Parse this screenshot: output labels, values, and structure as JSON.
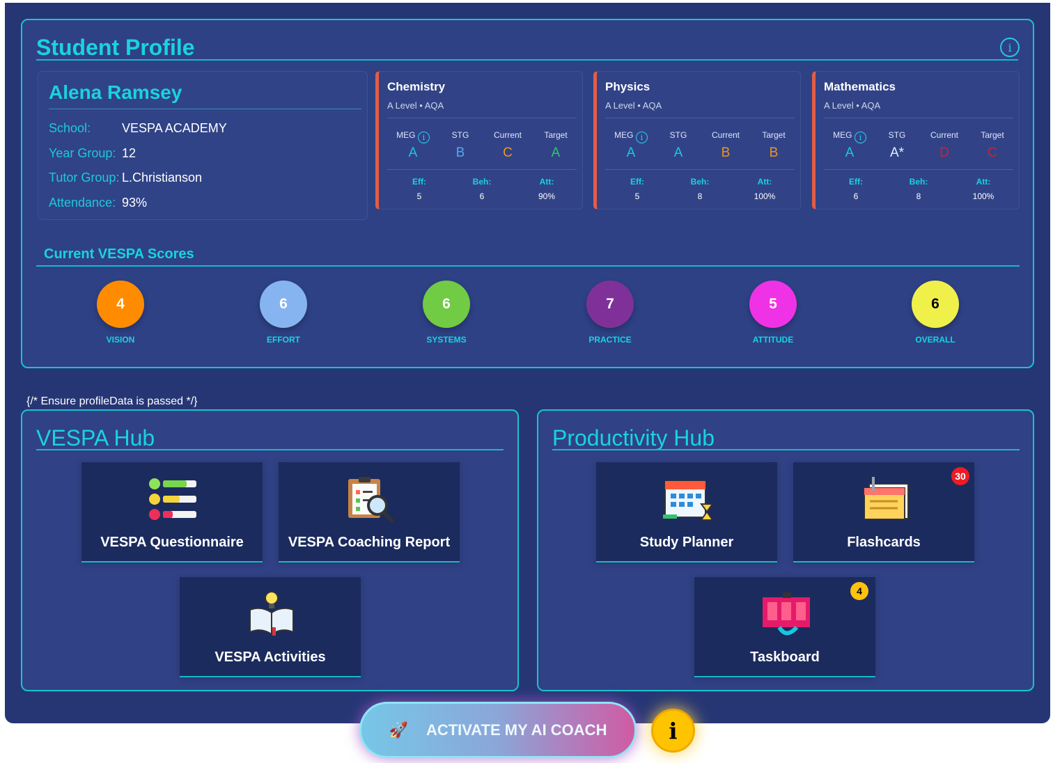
{
  "page": {
    "profile_title": "Student Profile",
    "comment_text": "{/* Ensure profileData is passed */}"
  },
  "student": {
    "name": "Alena Ramsey",
    "details": [
      {
        "label": "School:",
        "value": "VESPA ACADEMY"
      },
      {
        "label": "Year Group:",
        "value": "12"
      },
      {
        "label": "Tutor Group:",
        "value": "L.Christianson"
      },
      {
        "label": "Attendance:",
        "value": "93%"
      }
    ]
  },
  "subjects": [
    {
      "name": "Chemistry",
      "meta": "A Level • AQA",
      "grades": [
        {
          "label": "MEG",
          "value": "A"
        },
        {
          "label": "STG",
          "value": "B"
        },
        {
          "label": "Current",
          "value": "C"
        },
        {
          "label": "Target",
          "value": "A"
        }
      ],
      "metrics": [
        {
          "label": "Eff:",
          "value": "5"
        },
        {
          "label": "Beh:",
          "value": "6"
        },
        {
          "label": "Att:",
          "value": "90%"
        }
      ]
    },
    {
      "name": "Physics",
      "meta": "A Level • AQA",
      "grades": [
        {
          "label": "MEG",
          "value": "A"
        },
        {
          "label": "STG",
          "value": "A"
        },
        {
          "label": "Current",
          "value": "B"
        },
        {
          "label": "Target",
          "value": "B"
        }
      ],
      "metrics": [
        {
          "label": "Eff:",
          "value": "5"
        },
        {
          "label": "Beh:",
          "value": "8"
        },
        {
          "label": "Att:",
          "value": "100%"
        }
      ]
    },
    {
      "name": "Mathematics",
      "meta": "A Level • AQA",
      "grades": [
        {
          "label": "MEG",
          "value": "A"
        },
        {
          "label": "STG",
          "value": "A*"
        },
        {
          "label": "Current",
          "value": "D"
        },
        {
          "label": "Target",
          "value": "C"
        }
      ],
      "metrics": [
        {
          "label": "Eff:",
          "value": "6"
        },
        {
          "label": "Beh:",
          "value": "8"
        },
        {
          "label": "Att:",
          "value": "100%"
        }
      ]
    }
  ],
  "scores": {
    "title": "Current VESPA Scores",
    "items": [
      {
        "label": "VISION",
        "value": "4",
        "color": "#ff8c00"
      },
      {
        "label": "EFFORT",
        "value": "6",
        "color": "#86b4f0"
      },
      {
        "label": "SYSTEMS",
        "value": "6",
        "color": "#72cb44"
      },
      {
        "label": "PRACTICE",
        "value": "7",
        "color": "#7f3199"
      },
      {
        "label": "ATTITUDE",
        "value": "5",
        "color": "#f032e6"
      },
      {
        "label": "OVERALL",
        "value": "6",
        "color": "#f0f04a"
      }
    ]
  },
  "vespa_hub": {
    "title": "VESPA Hub",
    "tiles": [
      {
        "label": "VESPA Questionnaire",
        "icon": "questionnaire-icon"
      },
      {
        "label": "VESPA Coaching Report",
        "icon": "coaching-report-icon"
      },
      {
        "label": "VESPA Activities",
        "icon": "activities-icon"
      }
    ]
  },
  "productivity_hub": {
    "title": "Productivity Hub",
    "tiles": [
      {
        "label": "Study Planner",
        "icon": "calendar-icon"
      },
      {
        "label": "Flashcards",
        "icon": "flashcards-icon",
        "badge": "30"
      },
      {
        "label": "Taskboard",
        "icon": "taskboard-icon",
        "badge": "4"
      }
    ]
  },
  "ai_coach": {
    "label": "ACTIVATE MY AI COACH",
    "rocket_icon": "🚀",
    "info_icon": "i"
  },
  "colors": {
    "accent": "#19d3df",
    "background": "#263675",
    "panel": "#2e4185",
    "tile": "#1b2b5e"
  }
}
